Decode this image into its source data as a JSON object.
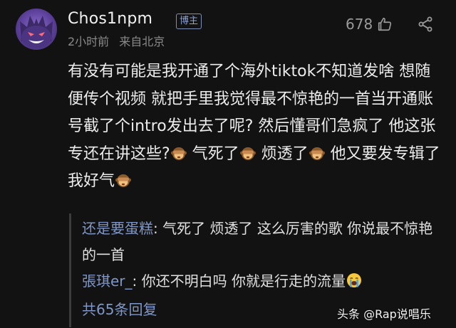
{
  "comment": {
    "username": "Chos1npm",
    "badge": "博主",
    "time_ago": "2小时前",
    "location": "来自北京",
    "likes": "678",
    "icons": {
      "avatar": "gengar-avatar",
      "like": "thumbs-up-icon",
      "share": "share-icon",
      "emoji": "see-no-evil-monkey-emoji",
      "cry_emoji": "loudly-crying-face-emoji"
    },
    "text_part1": "有没有可能是我开通了个海外tiktok不知道发啥 想随便传个视频 就把手里我觉得最不惊艳的一首当开通账号截了个intro发出去了呢? 然后懂哥们急疯了 他这张专还在讲这些?",
    "text_part2": " 气死了",
    "text_part3": " 烦透了",
    "text_part4": " 他又要发专辑了 我好气"
  },
  "replies": {
    "items": [
      {
        "author": "还是要蛋糕",
        "separator": ":",
        "text": " 气死了 烦透了 这么厉害的歌 你说最不惊艳的一首"
      },
      {
        "author": "張琪er_",
        "separator": ":",
        "text": " 你还不明白吗 你就是行走的流量"
      }
    ],
    "more_label": "共65条回复"
  },
  "watermark": {
    "text": "头条 @Rap说唱乐"
  },
  "colors": {
    "background": "#121212",
    "text": "#ececec",
    "muted": "#8a8a8a",
    "link_blue": "#7f97c8",
    "badge_border": "#7e8fb6"
  }
}
